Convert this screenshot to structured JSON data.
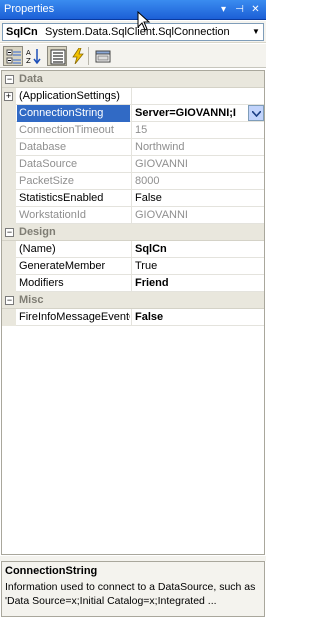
{
  "window": {
    "title": "Properties"
  },
  "title_buttons": [
    "▾",
    "⊣",
    "✕"
  ],
  "object": {
    "name": "SqlCn",
    "type": "System.Data.SqlClient.SqlConnection"
  },
  "toolbar": [
    "categorized",
    "alphabetical",
    "properties",
    "events",
    "property-pages"
  ],
  "categories": [
    {
      "name": "Data",
      "rows": [
        {
          "name": "(ApplicationSettings)",
          "value": "",
          "expandable": true
        },
        {
          "name": "ConnectionString",
          "value": "Server=GIOVANNI;I",
          "selected": true
        },
        {
          "name": "ConnectionTimeout",
          "value": "15",
          "readonly": true
        },
        {
          "name": "Database",
          "value": "Northwind",
          "readonly": true
        },
        {
          "name": "DataSource",
          "value": "GIOVANNI",
          "readonly": true
        },
        {
          "name": "PacketSize",
          "value": "8000",
          "readonly": true
        },
        {
          "name": "StatisticsEnabled",
          "value": "False"
        },
        {
          "name": "WorkstationId",
          "value": "GIOVANNI",
          "readonly": true
        }
      ]
    },
    {
      "name": "Design",
      "rows": [
        {
          "name": "(Name)",
          "value": "SqlCn",
          "bold": true
        },
        {
          "name": "GenerateMember",
          "value": "True"
        },
        {
          "name": "Modifiers",
          "value": "Friend",
          "bold": true
        }
      ]
    },
    {
      "name": "Misc",
      "rows": [
        {
          "name": "FireInfoMessageEventOnUserErrors",
          "value": "False",
          "bold": true
        }
      ]
    }
  ],
  "description": {
    "title": "ConnectionString",
    "text": "Information used to connect to a DataSource, such as 'Data Source=x;Initial Catalog=x;Integrated ..."
  }
}
